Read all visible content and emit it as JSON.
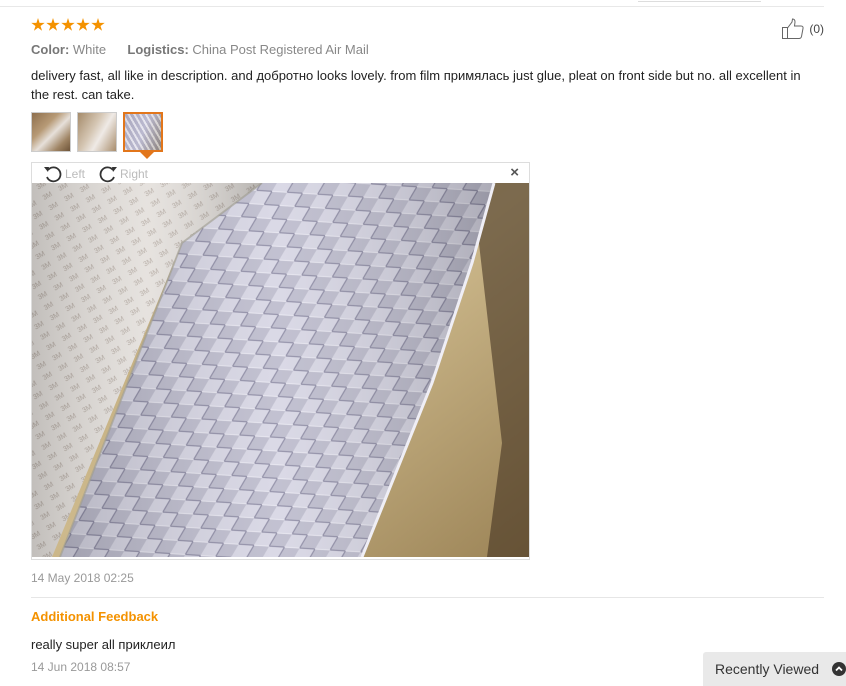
{
  "review": {
    "rating": 5,
    "helpful_count": "(0)",
    "color_label": "Color:",
    "color_value": "White",
    "logistics_label": "Logistics:",
    "logistics_value": "China Post Registered Air Mail",
    "text": "delivery fast, all like in description. and добротно looks lovely. from film примялась just glue, pleat on front side but no. all excellent in the rest. can take.",
    "thumbnail_count": 3,
    "active_thumbnail": 3,
    "viewer": {
      "rotate_left_label": "Left",
      "rotate_right_label": "Right",
      "close_symbol": "×"
    },
    "date": "14 May 2018 02:25",
    "additional_feedback": {
      "title": "Additional Feedback",
      "text": "really super all приклеил",
      "date": "14 Jun 2018 08:57"
    }
  },
  "recently_viewed": {
    "label": "Recently Viewed"
  },
  "colors": {
    "accent_orange": "#f49200",
    "active_thumb_border": "#e2761b",
    "muted_text": "#999999"
  },
  "icons": [
    "star-icon",
    "thumbs-up-icon",
    "rotate-left-icon",
    "rotate-right-icon",
    "close-icon",
    "chevron-up-icon"
  ]
}
